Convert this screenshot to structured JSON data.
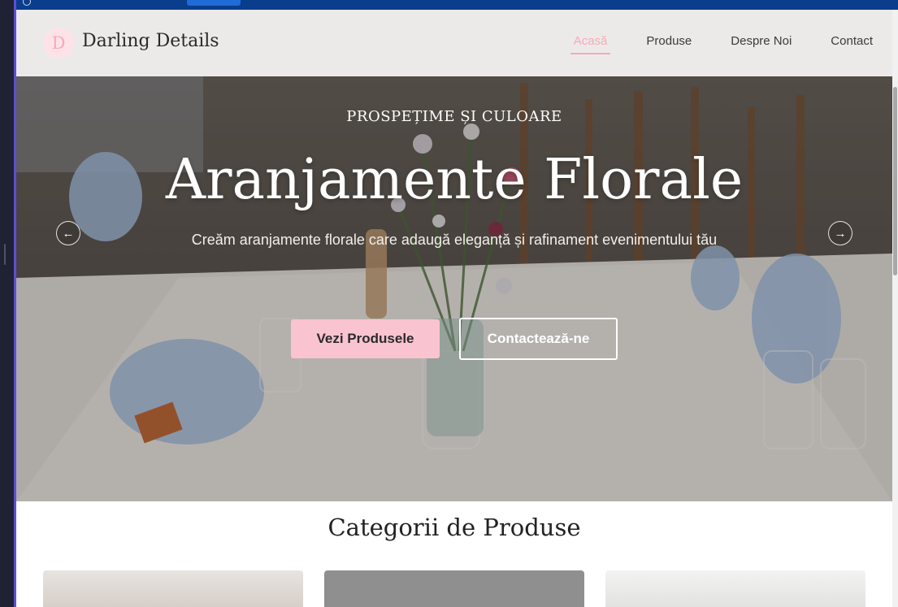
{
  "colors": {
    "accent_pink": "#f7a9b8",
    "button_pink": "#f9c3cf",
    "window_blue": "#0a3d8c"
  },
  "header": {
    "logo_letter": "D",
    "brand": "Darling Details",
    "nav": [
      {
        "label": "Acasă",
        "active": true
      },
      {
        "label": "Produse",
        "active": false
      },
      {
        "label": "Despre Noi",
        "active": false
      },
      {
        "label": "Contact",
        "active": false
      }
    ]
  },
  "hero": {
    "kicker": "PROSPEȚIME ȘI CULOARE",
    "title": "Aranjamente Florale",
    "subtitle": "Creăm aranjamente florale care adaugă eleganță și rafinament evenimentului tău",
    "primary_button": "Vezi Produsele",
    "secondary_button": "Contactează-ne",
    "prev_icon": "arrow-left-icon",
    "next_icon": "arrow-right-icon"
  },
  "categories": {
    "title": "Categorii de Produse"
  }
}
